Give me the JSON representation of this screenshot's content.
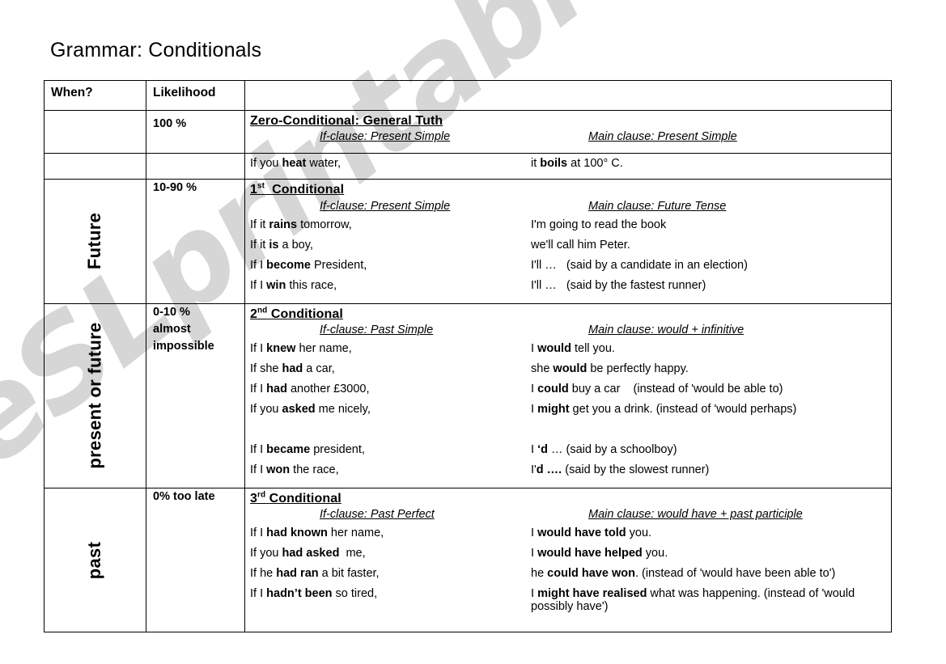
{
  "page": {
    "title": "Grammar: Conditionals",
    "watermark": "eSLprintables.com"
  },
  "table": {
    "headers": {
      "when": "When?",
      "likelihood": "Likelihood",
      "content": ""
    },
    "rows": [
      {
        "when": "",
        "likelihood": "100 %",
        "section_title": "Zero-Conditional: General Tuth",
        "ordinal": "",
        "if_heading": "If-clause: Present Simple",
        "main_heading": "Main clause: Present Simple",
        "examples": [
          {
            "if": "If you heat water,",
            "if_bold": "heat",
            "main": "it boils at 100° C.",
            "main_bold": "boils"
          }
        ]
      },
      {
        "when": "Future",
        "likelihood": "10-90 %",
        "section_title": "Conditional",
        "ordinal": "1",
        "ordinal_sup": "st",
        "if_heading": "If-clause: Present Simple",
        "main_heading": "Main clause: Future Tense",
        "examples": [
          {
            "if_pre": "If it ",
            "if_bold": "rains",
            "if_post": " tomorrow,",
            "main_pre": "",
            "main_bold": "",
            "main_post": "I'm going to read the book"
          },
          {
            "if_pre": "If it ",
            "if_bold": "is",
            "if_post": " a boy,",
            "main_pre": "",
            "main_bold": "",
            "main_post": "we'll call him Peter."
          },
          {
            "if_pre": "If I ",
            "if_bold": "become",
            "if_post": " President,",
            "main_pre": "",
            "main_bold": "",
            "main_post": "I'll …   (said by a candidate in an election)"
          },
          {
            "if_pre": "If I ",
            "if_bold": "win",
            "if_post": " this race,",
            "main_pre": "",
            "main_bold": "",
            "main_post": "I'll …   (said by the fastest runner)"
          }
        ]
      },
      {
        "when": "present or future",
        "likelihood": "0-10 %\nalmost\nimpossible",
        "section_title": "Conditional",
        "ordinal": "2",
        "ordinal_sup": "nd",
        "if_heading": "If-clause: Past Simple",
        "main_heading": "Main clause: would + infinitive",
        "examples": [
          {
            "if_pre": "If I ",
            "if_bold": "knew",
            "if_post": " her name,",
            "main_pre": "I ",
            "main_bold": "would",
            "main_post": " tell you."
          },
          {
            "if_pre": "If she ",
            "if_bold": "had",
            "if_post": " a car,",
            "main_pre": "she ",
            "main_bold": "would",
            "main_post": " be perfectly happy."
          },
          {
            "if_pre": "If I ",
            "if_bold": "had",
            "if_post": " another £3000,",
            "main_pre": "I ",
            "main_bold": "could",
            "main_post": " buy a car    (instead of 'would be able to)"
          },
          {
            "if_pre": "If you ",
            "if_bold": "asked",
            "if_post": " me nicely,",
            "main_pre": "I ",
            "main_bold": "might",
            "main_post": " get you a drink. (instead of 'would perhaps)"
          },
          {
            "blank": true
          },
          {
            "if_pre": "If I ",
            "if_bold": "became",
            "if_post": " president,",
            "main_pre": "I ",
            "main_bold": "‘d",
            "main_post": " … (said by a schoolboy)"
          },
          {
            "if_pre": "If I ",
            "if_bold": "won",
            "if_post": " the race,",
            "main_pre": "I'",
            "main_bold": "d ….",
            "main_post": " (said by the slowest runner)"
          }
        ]
      },
      {
        "when": "past",
        "likelihood": "0% too late",
        "section_title": "Conditional",
        "ordinal": "3",
        "ordinal_sup": "rd",
        "if_heading": "If-clause: Past Perfect",
        "main_heading": "Main clause: would have + past participle",
        "examples": [
          {
            "if_pre": "If I ",
            "if_bold": "had known",
            "if_post": " her name,",
            "main_pre": "I ",
            "main_bold": "would have told",
            "main_post": " you."
          },
          {
            "if_pre": "If you ",
            "if_bold": "had asked",
            "if_post": "  me,",
            "main_pre": "I ",
            "main_bold": "would have helped",
            "main_post": " you."
          },
          {
            "if_pre": "If he ",
            "if_bold": "had ran",
            "if_post": " a bit faster,",
            "main_pre": "he ",
            "main_bold": "could have won",
            "main_post": ". (instead of 'would have been able to')"
          },
          {
            "if_pre": "If I ",
            "if_bold": "hadn’t been",
            "if_post": " so tired,",
            "main_pre": "I ",
            "main_bold": "might have realised",
            "main_post": " what was happening. (instead of 'would possibly have')"
          }
        ]
      }
    ]
  }
}
